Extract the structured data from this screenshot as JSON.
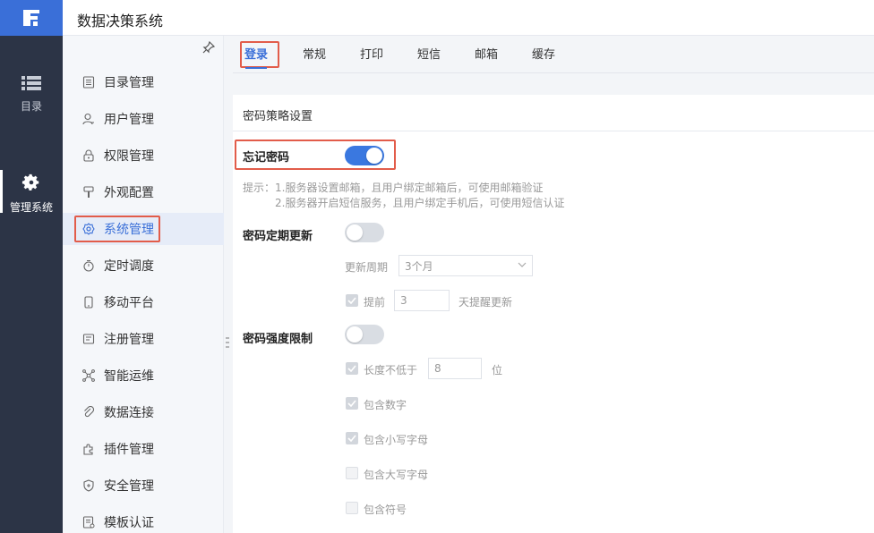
{
  "app": {
    "title": "数据决策系统"
  },
  "rail": {
    "items": [
      {
        "label": "目录",
        "icon": "list-icon"
      },
      {
        "label": "管理系统",
        "icon": "gear-icon"
      }
    ]
  },
  "sidebar": {
    "items": [
      {
        "label": "目录管理",
        "icon": "catalog-icon"
      },
      {
        "label": "用户管理",
        "icon": "user-icon"
      },
      {
        "label": "权限管理",
        "icon": "lock-icon"
      },
      {
        "label": "外观配置",
        "icon": "brush-icon"
      },
      {
        "label": "系统管理",
        "icon": "gear-icon",
        "active": true
      },
      {
        "label": "定时调度",
        "icon": "timer-icon"
      },
      {
        "label": "移动平台",
        "icon": "mobile-icon"
      },
      {
        "label": "注册管理",
        "icon": "register-icon"
      },
      {
        "label": "智能运维",
        "icon": "ops-icon"
      },
      {
        "label": "数据连接",
        "icon": "link-icon"
      },
      {
        "label": "插件管理",
        "icon": "plugin-icon"
      },
      {
        "label": "安全管理",
        "icon": "shield-icon"
      },
      {
        "label": "模板认证",
        "icon": "template-icon"
      }
    ]
  },
  "tabs": [
    "登录",
    "常规",
    "打印",
    "短信",
    "邮箱",
    "缓存"
  ],
  "panel": {
    "section_title": "密码策略设置",
    "forget_password": {
      "label": "忘记密码",
      "on": true
    },
    "hint_line1": "提示：1.服务器设置邮箱，且用户绑定邮箱后，可使用邮箱验证",
    "hint_line2": "2.服务器开启短信服务，且用户绑定手机后，可使用短信认证",
    "periodic_update": {
      "label": "密码定期更新",
      "on": false,
      "period_label": "更新周期",
      "period_value": "3个月",
      "advance_label": "提前",
      "advance_value": "3",
      "advance_suffix": "天提醒更新"
    },
    "strength": {
      "label": "密码强度限制",
      "on": false,
      "min_length_label": "长度不低于",
      "min_length_value": "8",
      "min_length_unit": "位",
      "digits": "包含数字",
      "lowercase": "包含小写字母",
      "uppercase": "包含大写字母",
      "symbols": "包含符号"
    }
  },
  "colors": {
    "accent": "#3a6fd8",
    "highlight": "#e25c4a",
    "rail": "#2c3446"
  }
}
